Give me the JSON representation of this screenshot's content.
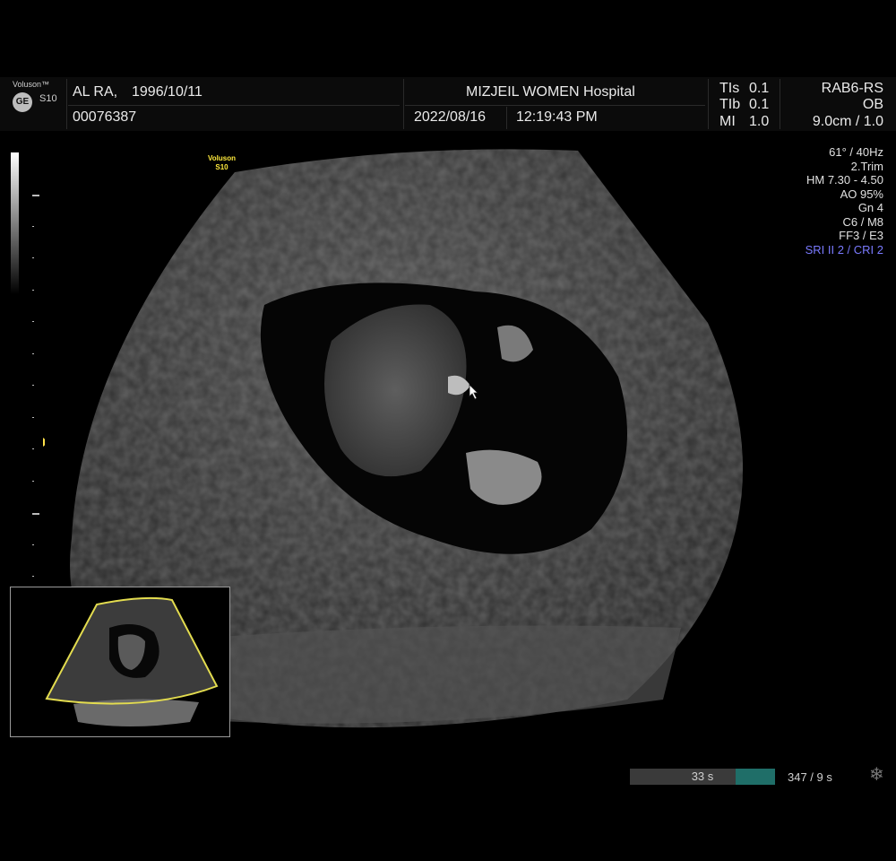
{
  "brand": {
    "name": "Voluson™",
    "model": "S10",
    "logo": "GE"
  },
  "header": {
    "patient_name": "AL RA,",
    "patient_dob": "1996/10/11",
    "patient_id": "00076387",
    "hospital": "MIZJEIL WOMEN Hospital",
    "date": "2022/08/16",
    "time": "12:19:43 PM",
    "tis_label": "TIs",
    "tis_value": "0.1",
    "tib_label": "TIb",
    "tib_value": "0.1",
    "mi_label": "MI",
    "mi_value": "1.0",
    "probe": "RAB6-RS",
    "app": "OB",
    "depth": "9.0cm / 1.0"
  },
  "params": [
    "61° / 40Hz",
    "2.Trim",
    "HM  7.30 - 4.50",
    "AO 95%",
    "Gn  4",
    "C6 / M8",
    "FF3 / E3"
  ],
  "sri_cri": "SRI II 2 / CRI 2",
  "image_label": {
    "brand": "Voluson",
    "model": "S10"
  },
  "cine": {
    "time": "33 s",
    "frames": "347 / 9 s",
    "progress": 0.27
  },
  "colors": {
    "sector_outline": "#e3dc4f",
    "accent_blue": "#7a7aff",
    "cine_fill": "#1f6e68"
  },
  "icons": {
    "settings": "gear-icon",
    "cursor": "pointer-icon",
    "focus": "focus-marker-icon"
  }
}
